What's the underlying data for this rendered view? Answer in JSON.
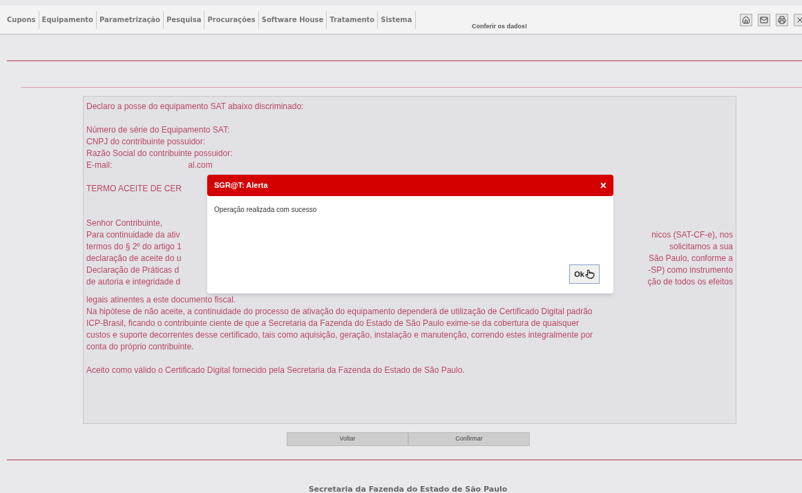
{
  "menu": {
    "items": [
      {
        "label": "Cupons"
      },
      {
        "label": "Equipamento"
      },
      {
        "label": "Parametrização"
      },
      {
        "label": "Pesquisa"
      },
      {
        "label": "Procurações"
      },
      {
        "label": "Software House"
      },
      {
        "label": "Tratamento"
      },
      {
        "label": "Sistema"
      }
    ],
    "tooltip": "Conferir os dados!"
  },
  "declaration": {
    "paragraphs": [
      [
        {
          "text": "Declaro a posse do equipamento SAT abaixo discriminado:"
        }
      ],
      [
        {
          "text": "Número de série do Equipamento SAT:"
        },
        {
          "text": "CNPJ do contribuinte possuidor:"
        },
        {
          "text": "Razão Social do contribuinte possuidor:"
        },
        {
          "left": "E-mail:",
          "right": "al.com"
        }
      ],
      [
        {
          "left": "TERMO ACEITE DE CER"
        }
      ],
      [
        {
          "text": "Senhor Contribuinte,"
        },
        {
          "left": "Para continuidade da ativ",
          "right": "nicos (SAT-CF-e), nos"
        },
        {
          "left": "termos do § 2º do artigo 1",
          "right": "solicitamos a sua"
        },
        {
          "left": "declaração de aceite do u",
          "right": "São Paulo, conforme a"
        },
        {
          "left": "Declaração de Práticas d",
          "right": "-SP) como instrumento"
        },
        {
          "left": "de autoria e integridade d",
          "right": "ção de todos os efeitos"
        },
        {
          "text": "legais atinentes a este documento fiscal."
        },
        {
          "text": "Na hipótese de não aceite, a continuidade do processo de ativação do equipamento dependerá de utilização de Certificado Digital padrão"
        },
        {
          "text": "ICP-Brasil, ficando o contribuinte ciente de que a Secretaria da Fazenda do Estado de São Paulo exime-se da cobertura de quaisquer"
        },
        {
          "text": "custos e suporte decorrentes desse certificado, tais como aquisição, geração, instalação e manutenção, correndo estes integralmente por"
        },
        {
          "text": "conta do próprio contribuinte."
        }
      ],
      [
        {
          "text": "Aceito como válido o Certificado Digital fornecido pela Secretaria da Fazenda do Estado de São Paulo."
        }
      ]
    ]
  },
  "buttons": [
    "Voltar",
    "Confirmar"
  ],
  "dialog": {
    "title": "SGR@T: Alerta",
    "close": "×",
    "message": "Operação realizada com sucesso",
    "button": "Ok"
  },
  "footer": "Secretaria da Fazenda do Estado de São Paulo"
}
